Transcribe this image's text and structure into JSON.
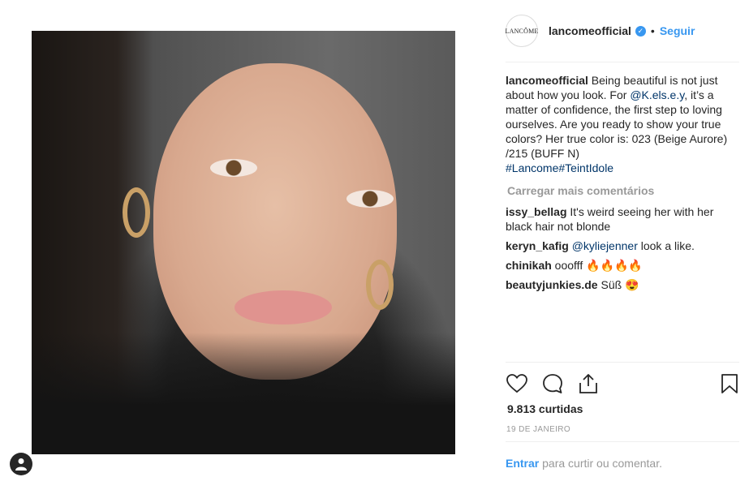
{
  "post": {
    "account": {
      "logo_text": "LANCÔME",
      "username": "lancomeofficial",
      "verified_icon": "verified-badge-icon",
      "separator": "•",
      "follow_label": "Seguir"
    },
    "caption": {
      "username": "lancomeofficial",
      "text_1": " Being beautiful is not just about how you look. For ",
      "mention": "@K.els.e.y",
      "text_2": ", it’s a matter of confidence, the first step to loving ourselves. Are you ready to show your true colors? Her true color is: 023 (Beige Aurore) /215 (BUFF N)",
      "hashtags": "#Lancome#TeintIdole"
    },
    "load_more_label": "Carregar mais comentários",
    "comments": [
      {
        "user": "issy_bellag",
        "text": " It's weird seeing her with her black hair not blonde"
      },
      {
        "user": "keryn_kafig",
        "mention": "@kyliejenner",
        "text": " look a like."
      },
      {
        "user": "chinikah",
        "text": " ooofff 🔥🔥🔥🔥"
      },
      {
        "user": "beautyjunkies.de",
        "text": " Süß 😍"
      }
    ],
    "likes": "9.813 curtidas",
    "date": "19 DE JANEIRO",
    "login_prompt": {
      "link_label": "Entrar",
      "text": " para curtir ou comentar."
    },
    "icons": {
      "like": "heart-icon",
      "comment": "comment-bubble-icon",
      "share": "share-icon",
      "save": "bookmark-icon",
      "profile": "user-avatar-icon"
    },
    "colors": {
      "accent": "#3897f0",
      "text": "#262626",
      "muted": "#999999",
      "divider": "#efefef"
    }
  }
}
